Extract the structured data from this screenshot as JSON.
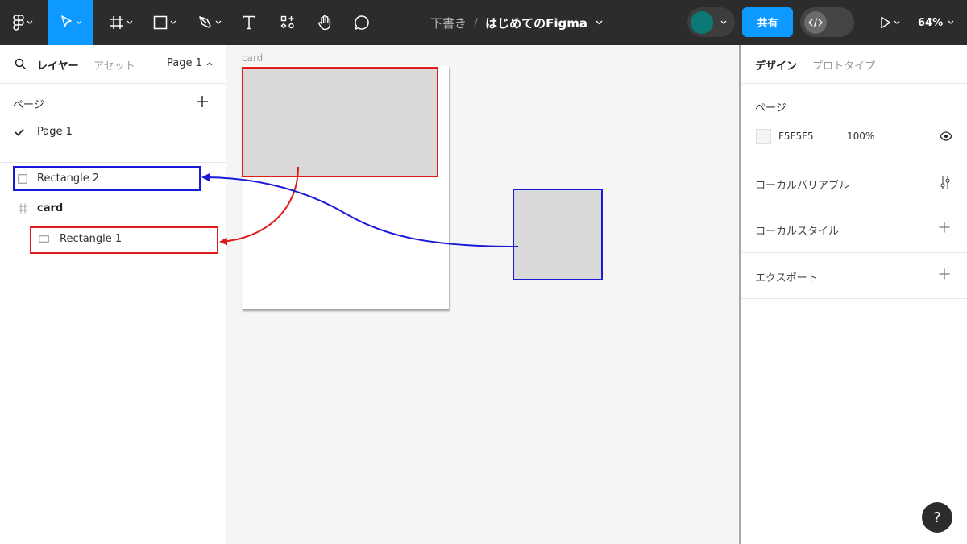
{
  "toolbar": {
    "title_draft": "下書き",
    "title_sep": "/",
    "file_name": "はじめてのFigma",
    "share_label": "共有",
    "zoom": "64%",
    "accent": "#0d99ff",
    "avatar_color": "#0b7a77",
    "icons": [
      "figma-menu-icon",
      "move-tool-icon",
      "frame-tool-icon",
      "rectangle-tool-icon",
      "pen-tool-icon",
      "text-tool-icon",
      "components-icon",
      "hand-tool-icon",
      "comment-icon",
      "dev-mode-icon",
      "present-icon"
    ]
  },
  "left_panel": {
    "tab_layers": "レイヤー",
    "tab_assets": "アセット",
    "page_selector": "Page 1",
    "pages_heading": "ページ",
    "pages": [
      {
        "label": "Page 1",
        "selected": true
      }
    ],
    "layers": [
      {
        "label": "Rectangle 2",
        "type": "rectangle"
      },
      {
        "label": "card",
        "type": "frame"
      },
      {
        "label": "Rectangle 1",
        "type": "rectangle"
      }
    ]
  },
  "canvas": {
    "frame_label": "card",
    "annotation_colors": {
      "red": "#e01b1b",
      "blue": "#1a1ad9"
    }
  },
  "right_panel": {
    "tab_design": "デザイン",
    "tab_prototype": "プロトタイプ",
    "page_heading": "ページ",
    "bg_hex": "F5F5F5",
    "bg_opacity": "100%",
    "sections": [
      "ローカルバリアブル",
      "ローカルスタイル",
      "エクスポート"
    ]
  },
  "help": "?"
}
